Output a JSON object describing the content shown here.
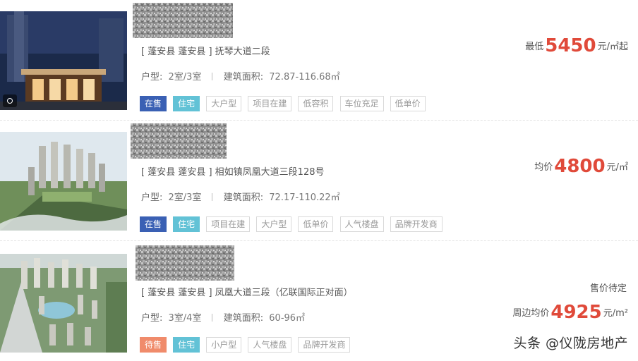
{
  "listings": [
    {
      "address": "[ 蓬安县 蓬安县 ] 抚琴大道二段",
      "layout_label": "户型:",
      "layout_value": "2室/3室",
      "area_label": "建筑面积:",
      "area_value": "72.87-116.68㎡",
      "tags": [
        "在售",
        "住宅",
        "大户型",
        "项目在建",
        "低容积",
        "车位充足",
        "低单价"
      ],
      "price_prefix": "最低",
      "price_value": "5450",
      "price_unit": "元/㎡起",
      "status": ""
    },
    {
      "address": "[ 蓬安县 蓬安县 ] 相如镇凤凰大道三段128号",
      "layout_label": "户型:",
      "layout_value": "2室/3室",
      "area_label": "建筑面积:",
      "area_value": "72.17-110.22㎡",
      "tags": [
        "在售",
        "住宅",
        "项目在建",
        "大户型",
        "低单价",
        "人气楼盘",
        "品牌开发商"
      ],
      "price_prefix": "均价",
      "price_value": "4800",
      "price_unit": "元/㎡",
      "status": ""
    },
    {
      "address": "[ 蓬安县 蓬安县 ] 凤凰大道三段（亿联国际正对面）",
      "layout_label": "户型:",
      "layout_value": "3室/4室",
      "area_label": "建筑面积:",
      "area_value": "60-96㎡",
      "tags": [
        "待售",
        "住宅",
        "小户型",
        "人气楼盘",
        "品牌开发商"
      ],
      "price_prefix": "周边均价",
      "price_value": "4925",
      "price_unit": "元/m²",
      "status": "售价待定"
    }
  ],
  "watermark": "头条 @仪陇房地产",
  "colors": {
    "price": "#e04a3a",
    "tag_on_sale": "#3a60b4",
    "tag_pending": "#f08b6b",
    "tag_residential": "#62c2d6"
  }
}
